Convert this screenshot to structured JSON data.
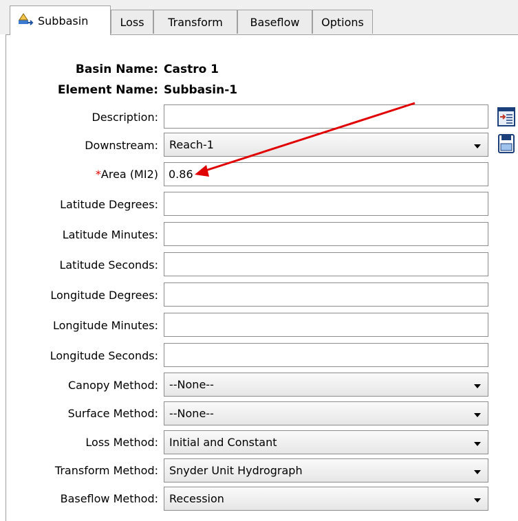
{
  "tabs": {
    "subbasin": "Subbasin",
    "loss": "Loss",
    "transform": "Transform",
    "baseflow": "Baseflow",
    "options": "Options"
  },
  "header": {
    "basin_label": "Basin Name:",
    "basin_value": "Castro 1",
    "element_label": "Element Name:",
    "element_value": "Subbasin-1"
  },
  "fields": {
    "description": {
      "label": "Description:",
      "value": ""
    },
    "downstream": {
      "label": "Downstream:",
      "value": "Reach-1"
    },
    "area": {
      "required_mark": "*",
      "label": "Area (MI2)",
      "value": "0.86"
    },
    "lat_deg": {
      "label": "Latitude Degrees:",
      "value": ""
    },
    "lat_min": {
      "label": "Latitude Minutes:",
      "value": ""
    },
    "lat_sec": {
      "label": "Latitude Seconds:",
      "value": ""
    },
    "lon_deg": {
      "label": "Longitude Degrees:",
      "value": ""
    },
    "lon_min": {
      "label": "Longitude Minutes:",
      "value": ""
    },
    "lon_sec": {
      "label": "Longitude Seconds:",
      "value": ""
    },
    "canopy": {
      "label": "Canopy Method:",
      "value": "--None--"
    },
    "surface": {
      "label": "Surface Method:",
      "value": "--None--"
    },
    "loss": {
      "label": "Loss Method:",
      "value": "Initial and Constant"
    },
    "transform": {
      "label": "Transform Method:",
      "value": "Snyder Unit Hydrograph"
    },
    "baseflow": {
      "label": "Baseflow Method:",
      "value": "Recession"
    }
  },
  "icons": {
    "subbasin_tab": "subbasin-icon",
    "description_editor": "description-editor-icon",
    "downstream_select": "downstream-select-icon"
  },
  "colors": {
    "required": "#e00000",
    "annotation_arrow": "#e00000"
  }
}
